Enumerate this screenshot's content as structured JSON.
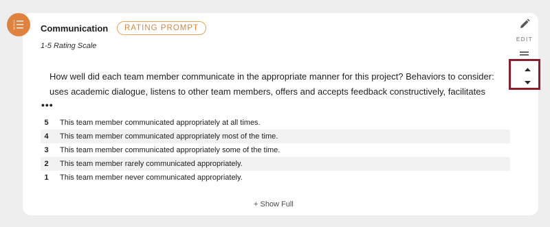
{
  "question": {
    "title": "Communication",
    "badge": "RATING PROMPT",
    "subtitle": "1-5 Rating Scale",
    "prompt": "How well did each team member communicate in the appropriate manner for this project? Behaviors to consider: uses academic dialogue, listens to other team members, offers and accepts feedback constructively, facilitates",
    "more": "•••",
    "show_full": "+ Show Full"
  },
  "actions": {
    "edit_label": "EDIT"
  },
  "scale": [
    {
      "value": "5",
      "text": "This team member communicated appropriately at all times."
    },
    {
      "value": "4",
      "text": "This team member communicated appropriately most of the time."
    },
    {
      "value": "3",
      "text": "This team member communicated appropriately some of the time."
    },
    {
      "value": "2",
      "text": "This team member rarely communicated appropriately."
    },
    {
      "value": "1",
      "text": "This team member never communicated appropriately."
    }
  ],
  "colors": {
    "accent": "#e0823d",
    "highlight_border": "#8a1e2c"
  },
  "icons": {
    "type": "list-rating-icon",
    "edit": "pencil-icon",
    "drag": "drag-handle-icon",
    "up": "caret-up-icon",
    "down": "caret-down-icon"
  }
}
